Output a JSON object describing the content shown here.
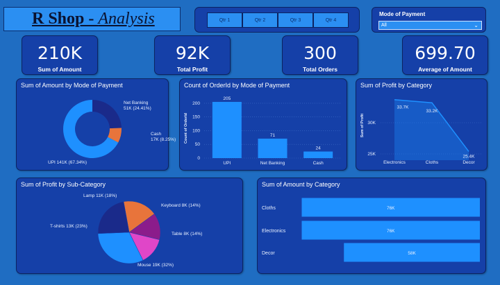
{
  "header": {
    "title_bold": "R Shop - ",
    "title_italic": "Analysis",
    "quarters": [
      "Qtr 1",
      "Qtr 2",
      "Qtr 3",
      "Qtr 4"
    ],
    "payment_filter": {
      "label": "Mode of Payment",
      "selected": "All"
    }
  },
  "kpis": [
    {
      "value": "210K",
      "caption": "Sum of Amount"
    },
    {
      "value": "92K",
      "caption": "Total Profit"
    },
    {
      "value": "300",
      "caption": "Total Orders"
    },
    {
      "value": "699.70",
      "caption": "Average of Amount"
    }
  ],
  "colors": {
    "background": "#1f6dc2",
    "panel": "#1540a8",
    "accent": "#1e90ff",
    "orange": "#e8743b",
    "navy": "#1a2a8a",
    "purple": "#8b1c8b",
    "pink": "#e046c8"
  },
  "chart_data": [
    {
      "type": "pie",
      "title": "Sum of Amount by Mode of Payment",
      "variant": "donut",
      "slices": [
        {
          "name": "UPI",
          "label": "UPI 141K (67.34%)",
          "value": 67.34,
          "color": "#1e90ff"
        },
        {
          "name": "Cash",
          "label_top": "Cash",
          "label_bottom": "17K (8.25%)",
          "value": 8.25,
          "color": "#e8743b"
        },
        {
          "name": "Net Banking",
          "label_top": "Net Banking",
          "label_bottom": "51K (24.41%)",
          "value": 24.41,
          "color": "#1a2a8a"
        }
      ]
    },
    {
      "type": "bar",
      "title": "Count of OrderId by Mode of Payment",
      "ylabel": "Count of OrderId",
      "categories": [
        "UPI",
        "Net Banking",
        "Cash"
      ],
      "values": [
        205,
        71,
        24
      ],
      "value_labels": [
        "205",
        "71",
        "24"
      ],
      "yticks": [
        0,
        50,
        100,
        150,
        200
      ],
      "ylim": [
        0,
        215
      ]
    },
    {
      "type": "area",
      "title": "Sum of Profit by Category",
      "ylabel": "Sum of Profit",
      "categories": [
        "Electronics",
        "Cloths",
        "Decor"
      ],
      "values": [
        33.7,
        33.2,
        25.4
      ],
      "value_labels": [
        "33.7K",
        "33.2K",
        "25.4K"
      ],
      "ytick_labels": [
        "25K",
        "30K"
      ],
      "yticks": [
        25,
        30
      ],
      "ylim": [
        24,
        35
      ]
    },
    {
      "type": "pie",
      "title": "Sum of Profit by Sub-Category",
      "slices": [
        {
          "name": "Mouse",
          "label": "Mouse 19K (32%)",
          "value": 32,
          "color": "#1e90ff"
        },
        {
          "name": "T-shirts",
          "label": "T-shirts 13K (23%)",
          "value": 23,
          "color": "#1a2a8a"
        },
        {
          "name": "Lamp",
          "label": "Lamp 11K (18%)",
          "value": 18,
          "color": "#e8743b"
        },
        {
          "name": "Keyboard",
          "label": "Keyboard 8K (14%)",
          "value": 14,
          "color": "#8b1c8b"
        },
        {
          "name": "Table",
          "label": "Table 8K (14%)",
          "value": 14,
          "color": "#e046c8"
        }
      ]
    },
    {
      "type": "bar",
      "orientation": "horizontal",
      "title": "Sum of Amount by Category",
      "categories": [
        "Cloths",
        "Electronics",
        "Decor"
      ],
      "values": [
        76,
        76,
        58
      ],
      "value_labels": [
        "76K",
        "76K",
        "58K"
      ],
      "xlim": [
        0,
        80
      ]
    }
  ]
}
